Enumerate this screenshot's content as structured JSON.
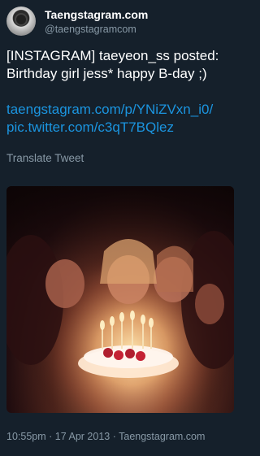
{
  "account": {
    "display_name": "Taengstagram.com",
    "handle": "@taengstagramcom"
  },
  "tweet": {
    "text": "[INSTAGRAM] taeyeon_ss posted: Birthday girl jess* happy B-day ;)",
    "link1": "taengstagram.com/p/YNiZVxn_i0/",
    "link2": "pic.twitter.com/c3qT7BQlez",
    "translate_label": "Translate Tweet",
    "time": "10:55pm",
    "date": "17 Apr 2013",
    "source": "Taengstagram.com",
    "separator": "·"
  },
  "icons": {
    "avatar": "avatar-photo-icon",
    "media": "birthday-photo"
  },
  "colors": {
    "background": "#15202b",
    "primary_text": "#ffffff",
    "secondary_text": "#8899a6",
    "link": "#1b95e0"
  }
}
